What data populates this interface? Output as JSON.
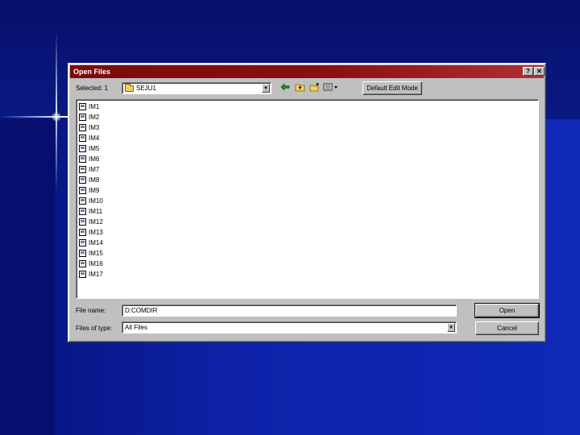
{
  "dialog": {
    "title": "Open Files",
    "help_button": "?",
    "close_button": "✕",
    "selected_label": "Selected: 1",
    "folder_value": "SEJU1",
    "default_edit_mode_button": "Default Edit Mode",
    "toolbar_icons": [
      "back-arrow-icon",
      "up-folder-icon",
      "new-folder-icon",
      "view-menu-icon"
    ],
    "files": [
      "IM1",
      "IM2",
      "IM3",
      "IM4",
      "IM5",
      "IM6",
      "IM7",
      "IM8",
      "IM9",
      "IM10",
      "IM11",
      "IM12",
      "IM13",
      "IM14",
      "IM15",
      "IM16",
      "IM17"
    ],
    "file_name_label": "File name:",
    "file_name_value": "D:COMDIR",
    "files_of_type_label": "Files of type:",
    "files_of_type_value": "All Files",
    "open_button": "Open",
    "cancel_button": "Cancel"
  },
  "colors": {
    "title_bar": "#8a1010",
    "background": "#0a1a8a",
    "dialog_face": "#c0c0c0"
  }
}
